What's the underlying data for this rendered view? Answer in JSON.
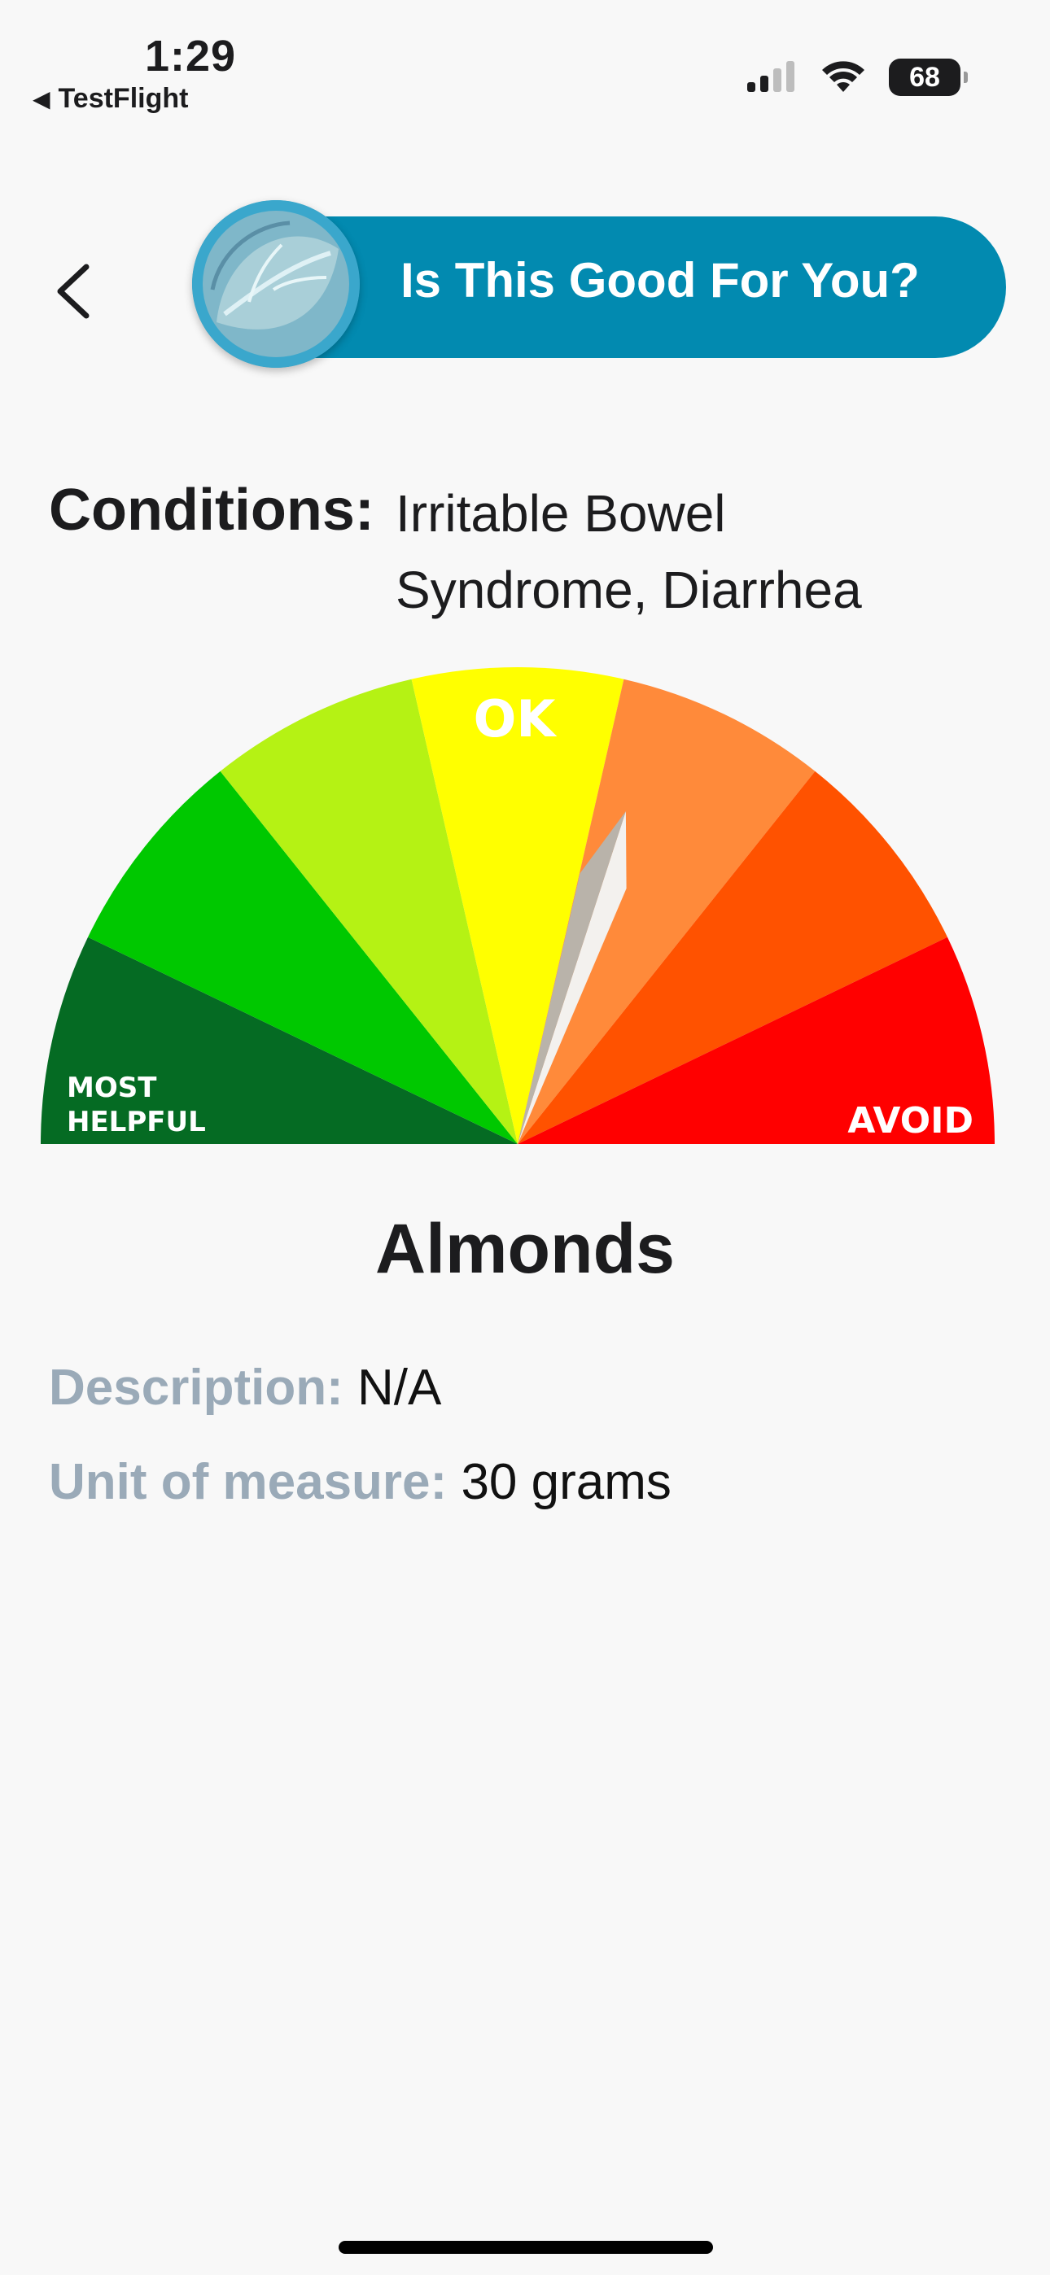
{
  "status_bar": {
    "time": "1:29",
    "back_app": "TestFlight",
    "battery": "68"
  },
  "header": {
    "title": "Is This Good For You?",
    "back_icon": "chevron-left-icon",
    "avatar_icon": "cabbage-leaf-image",
    "pill_color": "#028ab0"
  },
  "conditions": {
    "label": "Conditions:",
    "value": "Irritable Bowel Syndrome, Diarrhea"
  },
  "gauge": {
    "label_top": "OK",
    "label_left_1": "MOST",
    "label_left_2": "HELPFUL",
    "label_right": "AVOID",
    "segment_colors": [
      "#056b23",
      "#00c800",
      "#b5f214",
      "#ffff00",
      "#ff8a3a",
      "#ff5200",
      "#ff0000"
    ],
    "needle_position": 0.6
  },
  "food": {
    "name": "Almonds",
    "description_label": "Description:",
    "description_value": "N/A",
    "unit_label": "Unit of measure:",
    "unit_value": "30 grams"
  }
}
